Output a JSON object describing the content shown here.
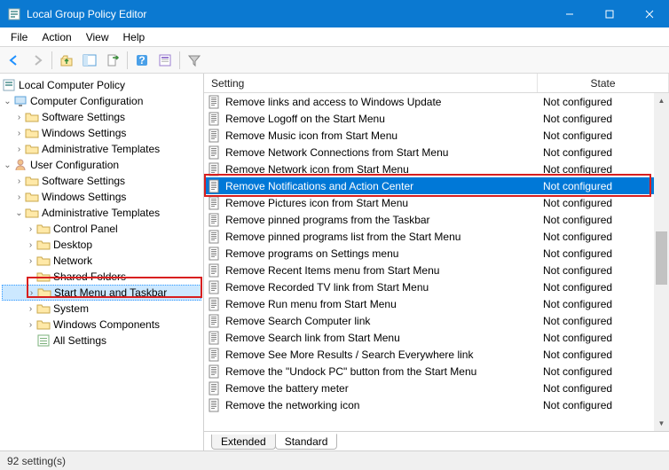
{
  "window": {
    "title": "Local Group Policy Editor"
  },
  "menubar": {
    "file": "File",
    "action": "Action",
    "view": "View",
    "help": "Help"
  },
  "toolbar_icons": [
    "back",
    "forward",
    "up",
    "show-hide-tree",
    "export",
    "help",
    "properties",
    "filter"
  ],
  "tree": {
    "root": "Local Computer Policy",
    "computer_config": "Computer Configuration",
    "cc_software": "Software Settings",
    "cc_windows": "Windows Settings",
    "cc_admin": "Administrative Templates",
    "user_config": "User Configuration",
    "uc_software": "Software Settings",
    "uc_windows": "Windows Settings",
    "uc_admin": "Administrative Templates",
    "control_panel": "Control Panel",
    "desktop": "Desktop",
    "network": "Network",
    "shared_folders": "Shared Folders",
    "start_menu": "Start Menu and Taskbar",
    "system": "System",
    "win_components": "Windows Components",
    "all_settings": "All Settings"
  },
  "columns": {
    "setting": "Setting",
    "state": "State"
  },
  "state_nc": "Not configured",
  "settings": [
    "Remove links and access to Windows Update",
    "Remove Logoff on the Start Menu",
    "Remove Music icon from Start Menu",
    "Remove Network Connections from Start Menu",
    "Remove Network icon from Start Menu",
    "Remove Notifications and Action Center",
    "Remove Pictures icon from Start Menu",
    "Remove pinned programs from the Taskbar",
    "Remove pinned programs list from the Start Menu",
    "Remove programs on Settings menu",
    "Remove Recent Items menu from Start Menu",
    "Remove Recorded TV link from Start Menu",
    "Remove Run menu from Start Menu",
    "Remove Search Computer link",
    "Remove Search link from Start Menu",
    "Remove See More Results / Search Everywhere link",
    "Remove the \"Undock PC\" button from the Start Menu",
    "Remove the battery meter",
    "Remove the networking icon"
  ],
  "selected_setting_index": 5,
  "tabs": {
    "extended": "Extended",
    "standard": "Standard"
  },
  "statusbar": {
    "text": "92 setting(s)"
  }
}
